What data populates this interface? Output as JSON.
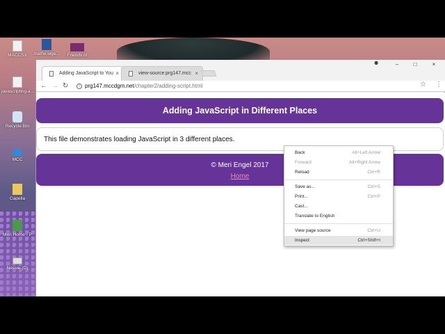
{
  "desktop": {
    "icons": [
      {
        "label": "MACCSX",
        "icon": "file-icon"
      },
      {
        "label": "mathe.wge...",
        "icon": "word-doc-icon"
      },
      {
        "label": "Friends of",
        "icon": "video-file-icon"
      },
      {
        "label": "javascripting.a...",
        "icon": "file-icon"
      },
      {
        "label": "Recycle Bin",
        "icon": "recycle-bin-icon"
      },
      {
        "label": "MCC",
        "icon": "onedrive-icon"
      },
      {
        "label": "Capella",
        "icon": "folder-icon"
      },
      {
        "label": "Meri Home - P",
        "icon": "google-drive-icon"
      },
      {
        "label": "Nessie (D)",
        "icon": "usb-drive-icon"
      }
    ]
  },
  "browser": {
    "tabs": [
      {
        "label": "Adding JavaScript to You",
        "active": true
      },
      {
        "label": "view-source:prg147.mcc",
        "active": false
      }
    ],
    "window_controls": {
      "minimize": "–",
      "maximize": "□",
      "close": "×"
    },
    "profile_glyph": "⚉",
    "nav": {
      "back": "←",
      "forward": "→",
      "reload": "↻"
    },
    "url": {
      "host": "prg147.mccdgm.net",
      "path": "/chapter2/adding-script.html"
    },
    "star": "☆",
    "menu": "⋮"
  },
  "page": {
    "heading": "Adding JavaScript in Different Places",
    "body_text": "This file demonstrates loading JavaScript in 3 different places.",
    "footer_copyright": "© Meri Engel 2017",
    "footer_link": "Home",
    "accent_color": "#663399",
    "link_color": "#ff8a80"
  },
  "context_menu": {
    "items": [
      {
        "label": "Back",
        "shortcut": "Alt+Left Arrow",
        "disabled": false
      },
      {
        "label": "Forward",
        "shortcut": "Alt+Right Arrow",
        "disabled": true
      },
      {
        "label": "Reload",
        "shortcut": "Ctrl+R",
        "disabled": false
      },
      {
        "label": "Save as...",
        "shortcut": "Ctrl+S",
        "disabled": false
      },
      {
        "label": "Print...",
        "shortcut": "Ctrl+P",
        "disabled": false
      },
      {
        "label": "Cast...",
        "shortcut": "",
        "disabled": false
      },
      {
        "label": "Translate to English",
        "shortcut": "",
        "disabled": false
      },
      {
        "label": "View page source",
        "shortcut": "Ctrl+U",
        "disabled": false
      },
      {
        "label": "Inspect",
        "shortcut": "Ctrl+Shift+I",
        "disabled": false,
        "highlighted": true
      }
    ]
  }
}
